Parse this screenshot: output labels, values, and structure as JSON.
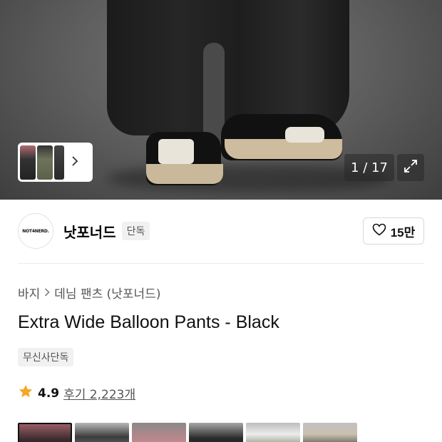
{
  "hero": {
    "counter": "1 / 17",
    "thumb_strip_icon": "chevron-right-icon",
    "expand_icon": "expand-icon"
  },
  "brand": {
    "logo_text": "NOT4NERD.",
    "name": "낫포너드",
    "tag": "단독",
    "likes": "15만",
    "like_icon": "heart-outline-icon"
  },
  "breadcrumb": {
    "items": [
      "바지",
      "데님 팬츠 (낫포너드)"
    ],
    "separator_icon": "chevron-right-icon"
  },
  "product": {
    "title": "Extra Wide Balloon Pants - Black",
    "badge": "무신사단독"
  },
  "rating": {
    "star_icon": "star-icon",
    "score": "4.9",
    "reviews": "후기 2,223개",
    "star_color": "#f5a623"
  },
  "gallery": {
    "selected_index": 0,
    "count_visible": 6
  }
}
